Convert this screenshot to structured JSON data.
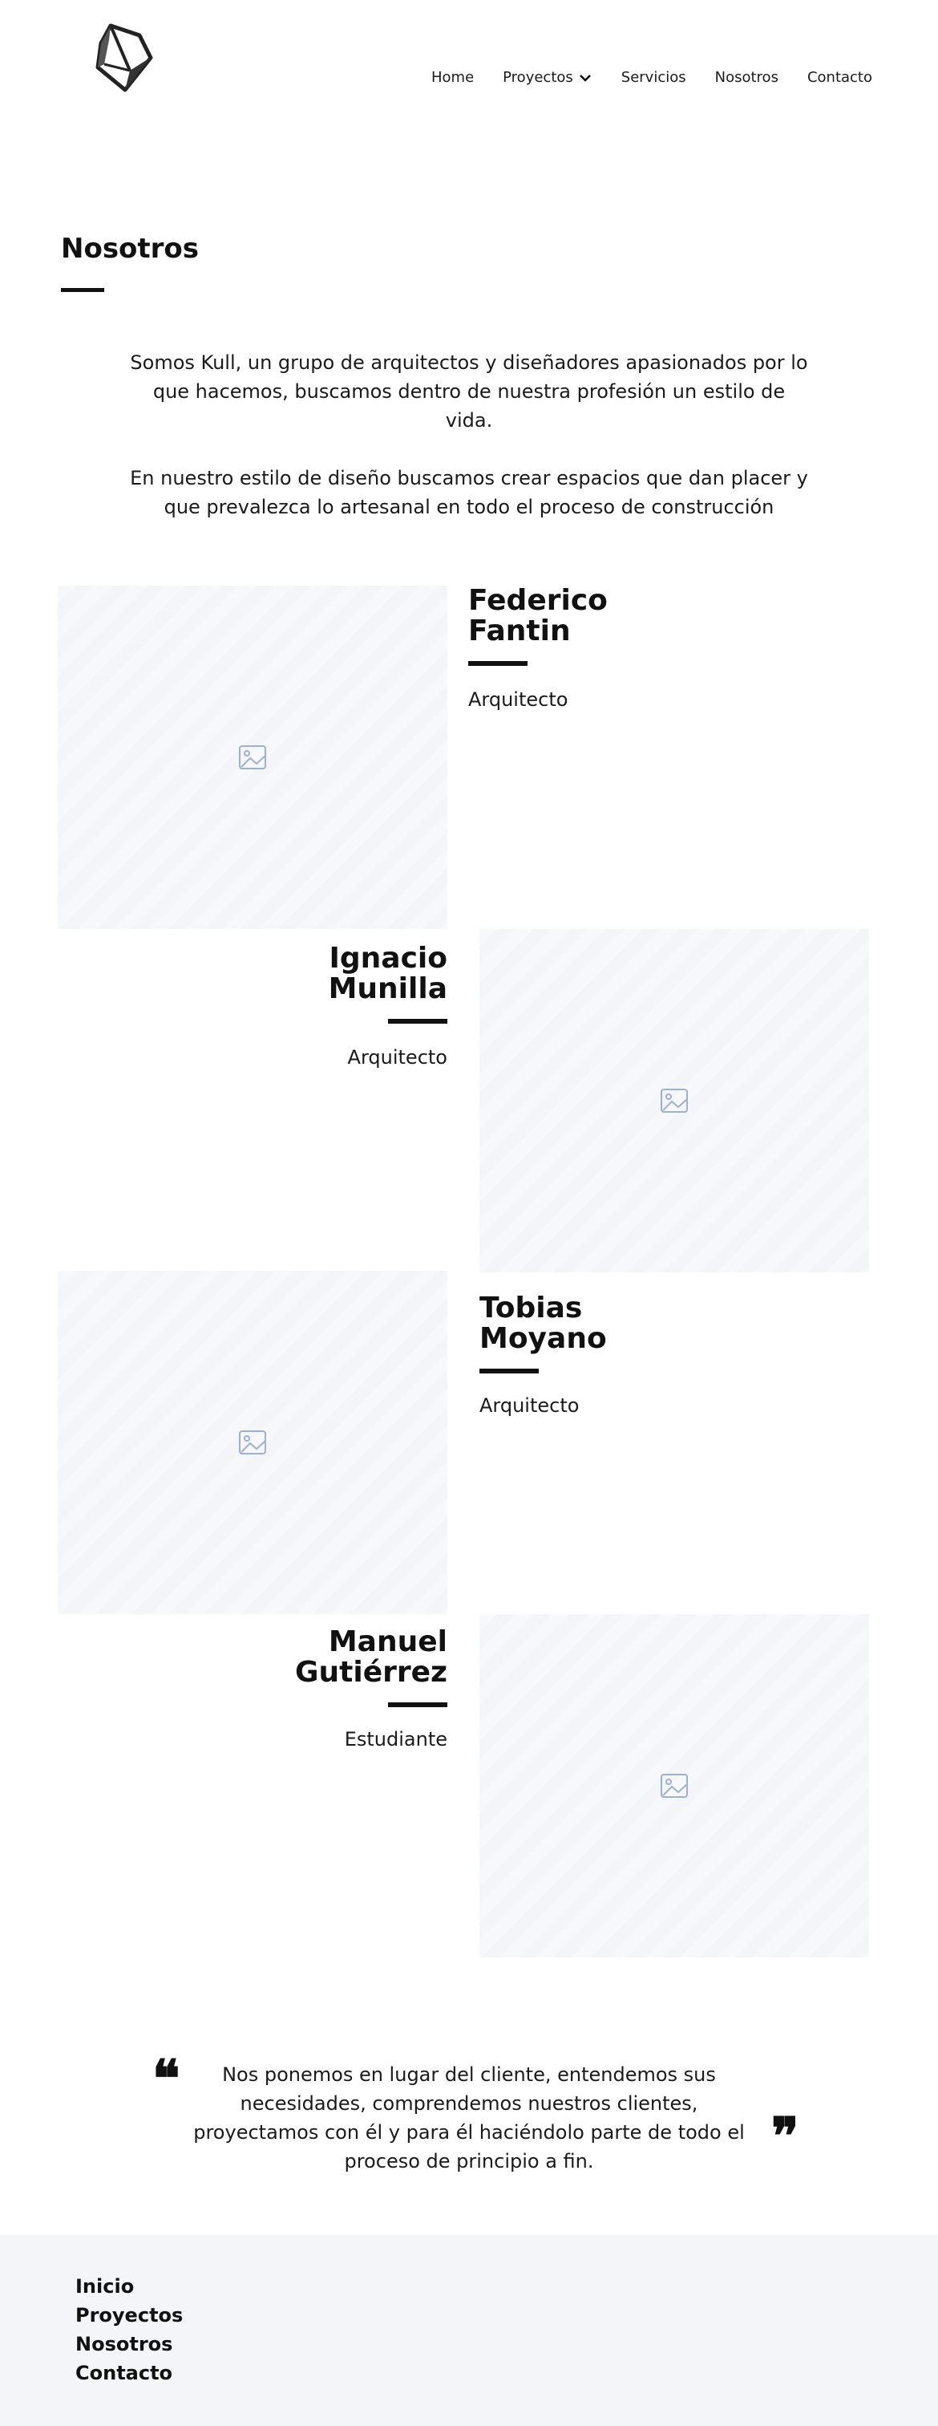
{
  "header": {
    "logo_icon": "kull-hexagon-logo",
    "nav": [
      {
        "label": "Home"
      },
      {
        "label": "Proyectos",
        "icon": "chevron-down-icon"
      },
      {
        "label": "Servicios"
      },
      {
        "label": "Nosotros"
      },
      {
        "label": "Contacto"
      }
    ]
  },
  "page": {
    "title": "Nosotros"
  },
  "intro": {
    "paragraph_1": "Somos Kull, un grupo de arquitectos y diseñadores apasionados por lo que hacemos, buscamos dentro de nuestra profesión un estilo de vida.",
    "paragraph_2": "En nuestro estilo de diseño buscamos crear espacios que dan placer y que prevalezca lo artesanal en todo el proceso de construcción"
  },
  "team": [
    {
      "name": "Federico\nFantin",
      "role": "Arquitecto",
      "photo_icon": "image-placeholder-icon"
    },
    {
      "name": "Ignacio\nMunilla",
      "role": "Arquitecto",
      "photo_icon": "image-placeholder-icon"
    },
    {
      "name": "Tobias\nMoyano",
      "role": "Arquitecto",
      "photo_icon": "image-placeholder-icon"
    },
    {
      "name": "Manuel\nGutiérrez",
      "role": "Estudiante",
      "photo_icon": "image-placeholder-icon"
    }
  ],
  "quote": {
    "text": "Nos ponemos en lugar del cliente, entendemos sus necesidades, comprendemos nuestros clientes, proyectamos con él y para él haciéndolo parte de todo el proceso de principio a fin.",
    "open_mark": "❝",
    "close_mark": "❞"
  },
  "footer": {
    "links": [
      "Inicio",
      "Proyectos",
      "Nosotros",
      "Contacto"
    ]
  },
  "colors": {
    "text": "#111111",
    "placeholder_bg": "#f7f8fb",
    "placeholder_icon": "#9fb0cc",
    "footer_bg": "#f4f5f8"
  }
}
